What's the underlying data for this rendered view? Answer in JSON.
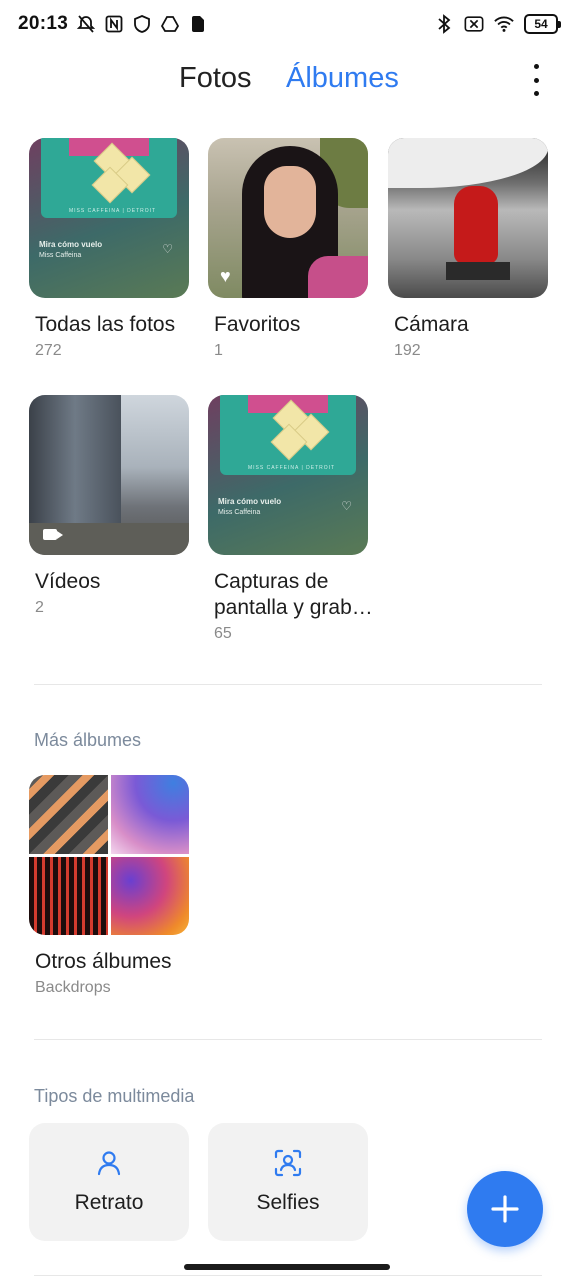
{
  "status_bar": {
    "time": "20:13",
    "battery": "54",
    "icons": [
      "mute-icon",
      "nfc-icon",
      "shield-icon",
      "drive-icon",
      "sim-icon",
      "bluetooth-icon",
      "no-sim-icon",
      "wifi-icon",
      "battery-icon"
    ]
  },
  "header": {
    "tabs": [
      {
        "label": "Fotos",
        "active": false
      },
      {
        "label": "Álbumes",
        "active": true
      }
    ],
    "menu_icon": "more-vert-icon"
  },
  "albums": [
    {
      "name": "Todas las fotos",
      "count": "272",
      "thumb_text_title": "Mira cómo vuelo",
      "thumb_text_sub": "Miss Caffeina",
      "thumb_band": "MISS CAFFEINA | DETROIT"
    },
    {
      "name": "Favoritos",
      "count": "1"
    },
    {
      "name": "Cámara",
      "count": "192"
    },
    {
      "name": "Vídeos",
      "count": "2"
    },
    {
      "name": "Capturas de pantalla y grab…",
      "count": "65",
      "thumb_text_title": "Mira cómo vuelo",
      "thumb_text_sub": "Miss Caffeina",
      "thumb_band": "MISS CAFFEINA | DETROIT"
    }
  ],
  "more_albums": {
    "title": "Más álbumes",
    "items": [
      {
        "name": "Otros álbumes",
        "subtitle": "Backdrops"
      }
    ]
  },
  "media_types": {
    "title": "Tipos de multimedia",
    "items": [
      {
        "label": "Retrato",
        "icon": "portrait-icon"
      },
      {
        "label": "Selfies",
        "icon": "selfie-icon"
      }
    ]
  },
  "fab": {
    "icon": "add-icon"
  },
  "colors": {
    "accent": "#2f7bf0",
    "section_title": "#7c8a9c",
    "count_text": "#8a8a8a"
  }
}
